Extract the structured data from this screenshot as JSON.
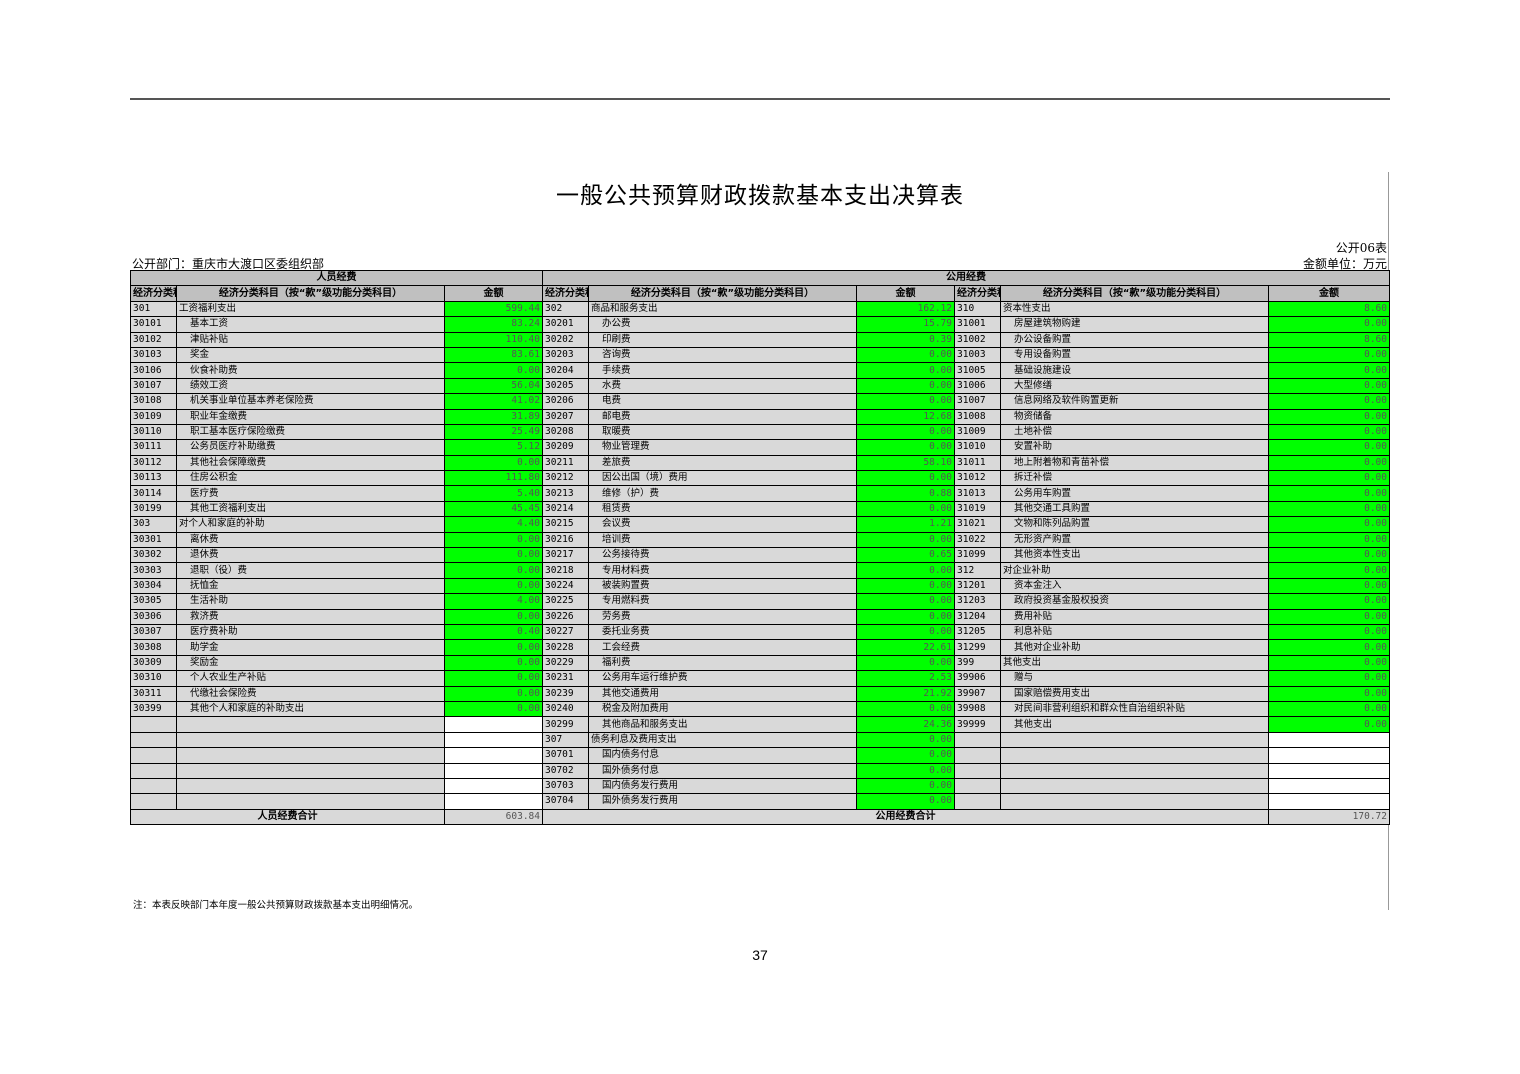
{
  "title": "一般公共预算财政拨款基本支出决算表",
  "table_no": "公开06表",
  "department": "公开部门：重庆市大渡口区委组织部",
  "unit": "金额单位：万元",
  "sections": {
    "personnel": "人员经费",
    "public": "公用经费"
  },
  "headers": {
    "code": "经济分类科目编码",
    "name": "经济分类科目（按“款”级功能分类科目）",
    "amount": "金额"
  },
  "rows": [
    [
      [
        "301",
        "工资福利支出",
        "599.44"
      ],
      [
        "302",
        "商品和服务支出",
        "162.12"
      ],
      [
        "310",
        "资本性支出",
        "8.60"
      ]
    ],
    [
      [
        "30101",
        "基本工资",
        "83.24"
      ],
      [
        "30201",
        "办公费",
        "15.79"
      ],
      [
        "31001",
        "房屋建筑物购建",
        "0.00"
      ]
    ],
    [
      [
        "30102",
        "津贴补贴",
        "110.40"
      ],
      [
        "30202",
        "印刷费",
        "0.39"
      ],
      [
        "31002",
        "办公设备购置",
        "8.60"
      ]
    ],
    [
      [
        "30103",
        "奖金",
        "83.61"
      ],
      [
        "30203",
        "咨询费",
        "0.00"
      ],
      [
        "31003",
        "专用设备购置",
        "0.00"
      ]
    ],
    [
      [
        "30106",
        "伙食补助费",
        "0.00"
      ],
      [
        "30204",
        "手续费",
        "0.00"
      ],
      [
        "31005",
        "基础设施建设",
        "0.00"
      ]
    ],
    [
      [
        "30107",
        "绩效工资",
        "56.04"
      ],
      [
        "30205",
        "水费",
        "0.00"
      ],
      [
        "31006",
        "大型修缮",
        "0.00"
      ]
    ],
    [
      [
        "30108",
        "机关事业单位基本养老保险费",
        "41.02"
      ],
      [
        "30206",
        "电费",
        "0.00"
      ],
      [
        "31007",
        "信息网络及软件购置更新",
        "0.00"
      ]
    ],
    [
      [
        "30109",
        "职业年金缴费",
        "31.89"
      ],
      [
        "30207",
        "邮电费",
        "12.68"
      ],
      [
        "31008",
        "物资储备",
        "0.00"
      ]
    ],
    [
      [
        "30110",
        "职工基本医疗保险缴费",
        "25.49"
      ],
      [
        "30208",
        "取暖费",
        "0.00"
      ],
      [
        "31009",
        "土地补偿",
        "0.00"
      ]
    ],
    [
      [
        "30111",
        "公务员医疗补助缴费",
        "5.12"
      ],
      [
        "30209",
        "物业管理费",
        "0.00"
      ],
      [
        "31010",
        "安置补助",
        "0.00"
      ]
    ],
    [
      [
        "30112",
        "其他社会保障缴费",
        "0.00"
      ],
      [
        "30211",
        "差旅费",
        "58.10"
      ],
      [
        "31011",
        "地上附着物和青苗补偿",
        "0.00"
      ]
    ],
    [
      [
        "30113",
        "住房公积金",
        "111.80"
      ],
      [
        "30212",
        "因公出国（境）费用",
        "0.00"
      ],
      [
        "31012",
        "拆迁补偿",
        "0.00"
      ]
    ],
    [
      [
        "30114",
        "医疗费",
        "5.40"
      ],
      [
        "30213",
        "维修（护）费",
        "0.88"
      ],
      [
        "31013",
        "公务用车购置",
        "0.00"
      ]
    ],
    [
      [
        "30199",
        "其他工资福利支出",
        "45.45"
      ],
      [
        "30214",
        "租赁费",
        "0.00"
      ],
      [
        "31019",
        "其他交通工具购置",
        "0.00"
      ]
    ],
    [
      [
        "303",
        "对个人和家庭的补助",
        "4.40"
      ],
      [
        "30215",
        "会议费",
        "1.21"
      ],
      [
        "31021",
        "文物和陈列品购置",
        "0.00"
      ]
    ],
    [
      [
        "30301",
        "离休费",
        "0.00"
      ],
      [
        "30216",
        "培训费",
        "0.00"
      ],
      [
        "31022",
        "无形资产购置",
        "0.00"
      ]
    ],
    [
      [
        "30302",
        "退休费",
        "0.00"
      ],
      [
        "30217",
        "公务接待费",
        "0.65"
      ],
      [
        "31099",
        "其他资本性支出",
        "0.00"
      ]
    ],
    [
      [
        "30303",
        "退职（役）费",
        "0.00"
      ],
      [
        "30218",
        "专用材料费",
        "0.00"
      ],
      [
        "312",
        "对企业补助",
        "0.00"
      ]
    ],
    [
      [
        "30304",
        "抚恤金",
        "0.00"
      ],
      [
        "30224",
        "被装购置费",
        "0.00"
      ],
      [
        "31201",
        "资本金注入",
        "0.00"
      ]
    ],
    [
      [
        "30305",
        "生活补助",
        "4.00"
      ],
      [
        "30225",
        "专用燃料费",
        "0.00"
      ],
      [
        "31203",
        "政府投资基金股权投资",
        "0.00"
      ]
    ],
    [
      [
        "30306",
        "救济费",
        "0.00"
      ],
      [
        "30226",
        "劳务费",
        "0.00"
      ],
      [
        "31204",
        "费用补贴",
        "0.00"
      ]
    ],
    [
      [
        "30307",
        "医疗费补助",
        "0.40"
      ],
      [
        "30227",
        "委托业务费",
        "0.00"
      ],
      [
        "31205",
        "利息补贴",
        "0.00"
      ]
    ],
    [
      [
        "30308",
        "助学金",
        "0.00"
      ],
      [
        "30228",
        "工会经费",
        "22.61"
      ],
      [
        "31299",
        "其他对企业补助",
        "0.00"
      ]
    ],
    [
      [
        "30309",
        "奖励金",
        "0.00"
      ],
      [
        "30229",
        "福利费",
        "0.00"
      ],
      [
        "399",
        "其他支出",
        "0.00"
      ]
    ],
    [
      [
        "30310",
        "个人农业生产补贴",
        "0.00"
      ],
      [
        "30231",
        "公务用车运行维护费",
        "2.53"
      ],
      [
        "39906",
        "赠与",
        "0.00"
      ]
    ],
    [
      [
        "30311",
        "代缴社会保险费",
        "0.00"
      ],
      [
        "30239",
        "其他交通费用",
        "21.92"
      ],
      [
        "39907",
        "国家赔偿费用支出",
        "0.00"
      ]
    ],
    [
      [
        "30399",
        "其他个人和家庭的补助支出",
        "0.00"
      ],
      [
        "30240",
        "税金及附加费用",
        "0.00"
      ],
      [
        "39908",
        "对民间非营利组织和群众性自治组织补贴",
        "0.00"
      ]
    ],
    [
      [
        "",
        "",
        ""
      ],
      [
        "30299",
        "其他商品和服务支出",
        "24.36"
      ],
      [
        "39999",
        "其他支出",
        "0.00"
      ]
    ],
    [
      [
        "",
        "",
        ""
      ],
      [
        "307",
        "债务利息及费用支出",
        "0.00"
      ],
      [
        "",
        "",
        ""
      ]
    ],
    [
      [
        "",
        "",
        ""
      ],
      [
        "30701",
        "国内债务付息",
        "0.00"
      ],
      [
        "",
        "",
        ""
      ]
    ],
    [
      [
        "",
        "",
        ""
      ],
      [
        "30702",
        "国外债务付息",
        "0.00"
      ],
      [
        "",
        "",
        ""
      ]
    ],
    [
      [
        "",
        "",
        ""
      ],
      [
        "30703",
        "国内债务发行费用",
        "0.00"
      ],
      [
        "",
        "",
        ""
      ]
    ],
    [
      [
        "",
        "",
        ""
      ],
      [
        "30704",
        "国外债务发行费用",
        "0.00"
      ],
      [
        "",
        "",
        ""
      ]
    ]
  ],
  "totals": {
    "personnel_label": "人员经费合计",
    "personnel": "603.84",
    "public_label": "公用经费合计",
    "public": "170.72"
  },
  "note": "注：本表反映部门本年度一般公共预算财政拨款基本支出明细情况。",
  "page_number": "37"
}
